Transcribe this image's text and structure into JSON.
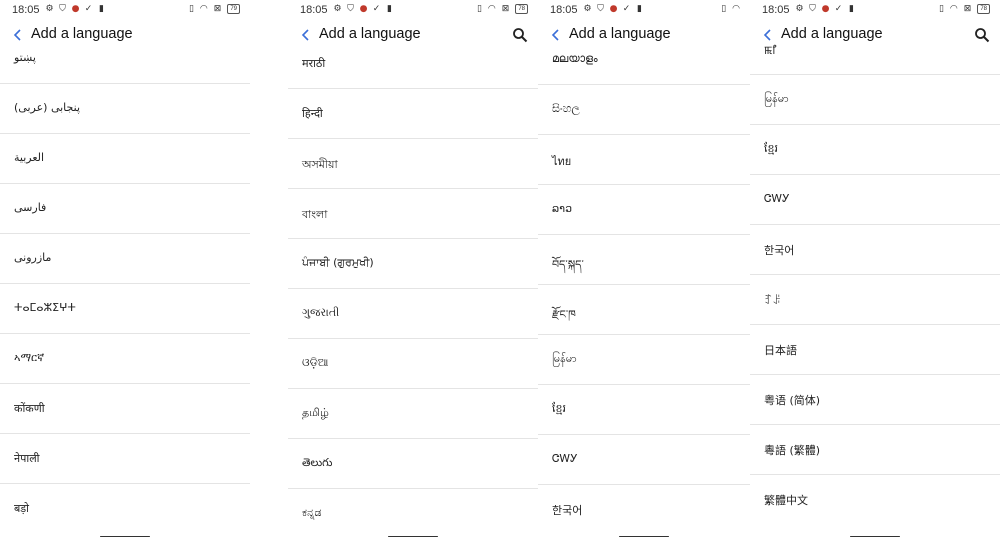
{
  "status": {
    "time": "18:05",
    "battery": "79",
    "battery_alt": "78"
  },
  "app_bar": {
    "title": "Add a language"
  },
  "screens": [
    {
      "items": [
        "پښتو",
        "پنجابی (عربی)",
        "العربية",
        "فارسی",
        "مازرونی",
        "ⵜⴰⵎⴰⵣⵉⵖⵜ",
        "ኣማርኛ",
        "कोंकणी",
        "नेपाली",
        "बड़ो"
      ]
    },
    {
      "items": [
        "मराठी",
        "हिन्दी",
        "অসমীয়া",
        "বাংলা",
        "ਪੰਜਾਬੀ (ਗੁਰਮੁਖੀ)",
        "ગુજરાતી",
        "ଓଡ଼ିଆ",
        "தமிழ்",
        "తెలుగు",
        "ಕನ್ನಡ"
      ]
    },
    {
      "items": [
        "മലയാളം",
        "සිංහල",
        "ไทย",
        "ລາວ",
        "བོད་སྐད་",
        "རྫོང་ཁ",
        "မြန်မာ",
        "ខ្មែរ",
        "ᏣᎳᎩ",
        "한국어"
      ]
    },
    {
      "items": [
        "ꯃꯤ",
        "မြန်မာ",
        "ខ្មែរ",
        "ᏣᎳᎩ",
        "한국어",
        "ꆈꌠ",
        "日本語",
        "粤语 (简体)",
        "粵語 (繁體)",
        "繁體中文"
      ]
    }
  ]
}
